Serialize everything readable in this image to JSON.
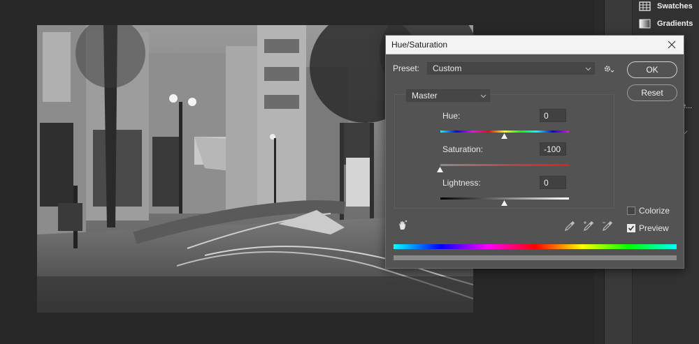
{
  "panels": {
    "swatches_label": "Swatches",
    "gradients_label": "Gradients",
    "stub_label": "e..."
  },
  "dialog": {
    "title": "Hue/Saturation",
    "preset_label": "Preset:",
    "preset_value": "Custom",
    "ok_label": "OK",
    "reset_label": "Reset",
    "channel_value": "Master",
    "hue": {
      "label": "Hue:",
      "value": "0"
    },
    "saturation": {
      "label": "Saturation:",
      "value": "-100"
    },
    "lightness": {
      "label": "Lightness:",
      "value": "0"
    },
    "colorize_label": "Colorize",
    "preview_label": "Preview",
    "colorize_checked": false,
    "preview_checked": true
  },
  "colors": {
    "dialog_bg": "#535353",
    "titlebar_bg": "#f3f3f3",
    "workspace_bg": "#282828"
  },
  "icons": [
    "hand-target-icon",
    "eyedropper-icon",
    "eyedropper-plus-icon",
    "eyedropper-minus-icon",
    "gear-icon",
    "close-icon",
    "swatches-icon",
    "gradients-icon"
  ]
}
